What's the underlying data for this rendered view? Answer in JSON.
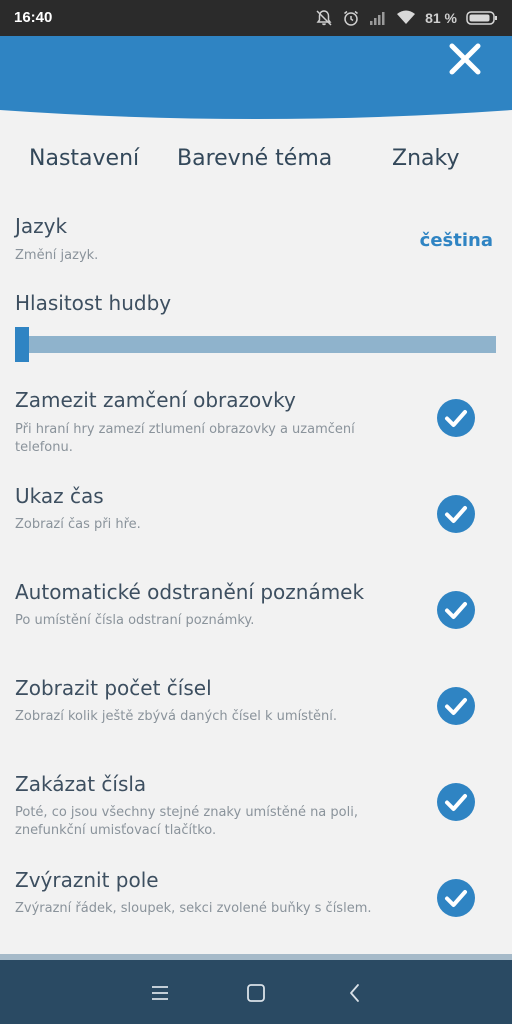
{
  "status_bar": {
    "time": "16:40",
    "battery_percent": "81 %",
    "icons": [
      "mute-icon",
      "alarm-icon",
      "signal-icon",
      "wifi-icon",
      "battery-icon"
    ]
  },
  "header": {
    "close_icon": "close-icon",
    "color": "#2f84c3"
  },
  "tabs": [
    {
      "label": "Nastavení"
    },
    {
      "label": "Barevné téma"
    },
    {
      "label": "Znaky"
    }
  ],
  "language": {
    "title": "Jazyk",
    "description": "Změní jazyk.",
    "value": "čeština"
  },
  "music_volume": {
    "title": "Hlasitost hudby",
    "level": 0.0
  },
  "settings": [
    {
      "title": "Zamezit zamčení obrazovky",
      "description": "Při hraní hry zamezí ztlumení obrazovky a uzamčení telefonu.",
      "checked": true
    },
    {
      "title": "Ukaz čas",
      "description": "Zobrazí čas při hře.",
      "checked": true
    },
    {
      "title": "Automatické odstranění poznámek",
      "description": "Po umístění čísla odstraní poznámky.",
      "checked": true
    },
    {
      "title": "Zobrazit počet čísel",
      "description": "Zobrazí kolik ještě zbývá daných čísel k umístění.",
      "checked": true
    },
    {
      "title": "Zakázat čísla",
      "description": "Poté, co jsou všechny stejné znaky umístěné na poli, znefunkční umisťovací tlačítko.",
      "checked": true
    },
    {
      "title": "Zvýraznit pole",
      "description": "Zvýrazní řádek, sloupek, sekci zvolené buňky s číslem.",
      "checked": true
    }
  ],
  "nav_bar": {
    "icons": [
      "menu-icon",
      "home-icon",
      "back-icon"
    ]
  },
  "colors": {
    "accent": "#2f84c3",
    "background": "#f2f2f2",
    "nav_bar": "#2a4a63",
    "slider_track": "#8fb3cc"
  }
}
